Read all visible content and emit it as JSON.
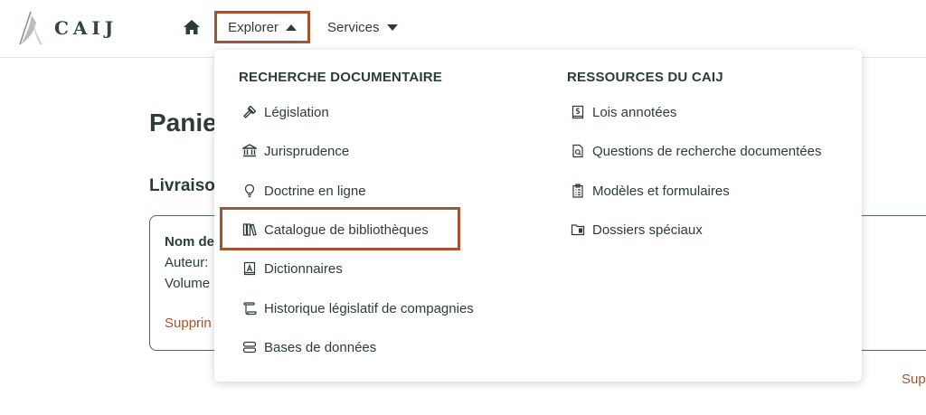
{
  "header": {
    "logo_text": "CAIJ",
    "nav": {
      "explorer_label": "Explorer",
      "services_label": "Services"
    }
  },
  "page": {
    "title": "Panie",
    "section_title": "Livraiso",
    "card": {
      "name_label": "Nom de",
      "author_label": "Auteur:",
      "volume_label": "Volume",
      "delete_label": "Supprin"
    },
    "side_delete_label": "Sup"
  },
  "menu": {
    "columns": [
      {
        "heading": "RECHERCHE DOCUMENTAIRE",
        "items": [
          {
            "label": "Législation",
            "icon": "gavel-icon"
          },
          {
            "label": "Jurisprudence",
            "icon": "courthouse-icon"
          },
          {
            "label": "Doctrine en ligne",
            "icon": "lightbulb-icon"
          },
          {
            "label": "Catalogue de bibliothèques",
            "icon": "books-icon"
          },
          {
            "label": "Dictionnaires",
            "icon": "dictionary-icon"
          },
          {
            "label": "Historique législatif de compagnies",
            "icon": "scroll-icon"
          },
          {
            "label": "Bases de données",
            "icon": "database-icon"
          }
        ]
      },
      {
        "heading": "RESSOURCES DU CAIJ",
        "items": [
          {
            "label": "Lois annotées",
            "icon": "annotated-law-icon"
          },
          {
            "label": "Questions de recherche documentées",
            "icon": "document-search-icon"
          },
          {
            "label": "Modèles et formulaires",
            "icon": "clipboard-icon"
          },
          {
            "label": "Dossiers spéciaux",
            "icon": "folder-icon"
          }
        ]
      }
    ]
  },
  "colors": {
    "accent": "#a4542f",
    "text": "#2c3e34",
    "border": "#506a5a"
  }
}
